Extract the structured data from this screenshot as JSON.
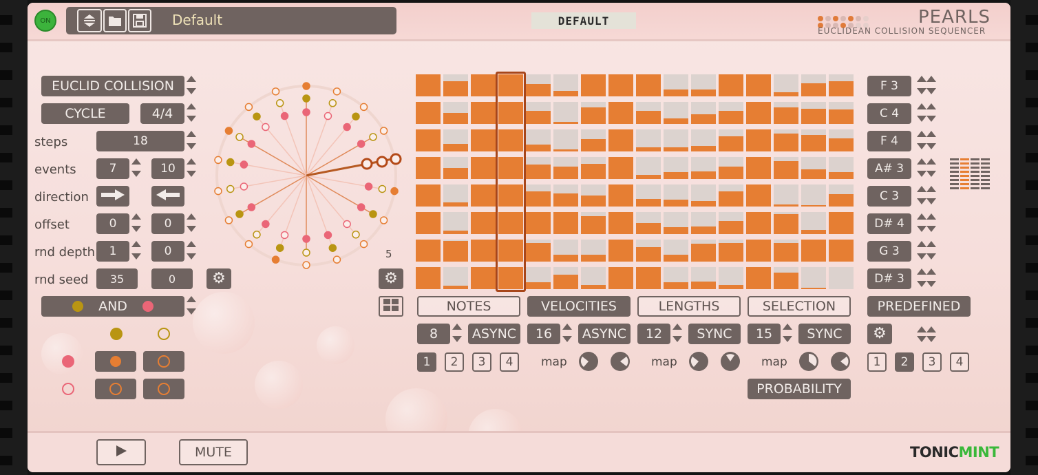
{
  "header": {
    "on_label": "ON",
    "preset_name": "Default",
    "preset_tag": "DEFAULT",
    "logo_title": "PEARLS",
    "logo_subtitle": "EUCLIDEAN COLLISION SEQUENCER",
    "icons": [
      "up-down-icon",
      "folder-icon",
      "save-icon"
    ]
  },
  "left": {
    "mode": "EUCLID COLLISION",
    "cycle_label": "CYCLE",
    "cycle_value": "4/4",
    "steps_label": "steps",
    "steps_value": "18",
    "events_label": "events",
    "events_a": "7",
    "events_b": "10",
    "direction_label": "direction",
    "offset_label": "offset",
    "offset_a": "0",
    "offset_b": "0",
    "rnd_depth_label": "rnd depth",
    "rnd_depth_a": "1",
    "rnd_depth_b": "0",
    "rnd_seed_label": "rnd seed",
    "rnd_seed_a": "35",
    "rnd_seed_b": "0",
    "logic_label": "AND"
  },
  "circle": {
    "count_label": "5"
  },
  "grid": {
    "fill_levels": [
      [
        1.0,
        0.7,
        1.0,
        1.0,
        0.55,
        0.25,
        1.0,
        1.0,
        1.0,
        0.3,
        0.3,
        1.0,
        1.0,
        0.2,
        0.6,
        0.7
      ],
      [
        1.0,
        0.5,
        1.0,
        1.0,
        0.6,
        0.1,
        0.75,
        1.0,
        0.6,
        0.25,
        0.45,
        0.6,
        1.0,
        0.75,
        0.7,
        0.65
      ],
      [
        1.0,
        0.35,
        1.0,
        1.0,
        0.3,
        0.1,
        0.55,
        1.0,
        0.2,
        0.2,
        0.25,
        0.7,
        1.0,
        0.8,
        0.75,
        0.6
      ],
      [
        1.0,
        0.5,
        1.0,
        1.0,
        0.65,
        0.55,
        0.7,
        1.0,
        0.2,
        0.3,
        0.35,
        0.55,
        1.0,
        0.8,
        0.45,
        0.3
      ],
      [
        1.0,
        0.2,
        1.0,
        1.0,
        0.7,
        0.6,
        0.5,
        1.0,
        0.35,
        0.3,
        0.25,
        0.7,
        1.0,
        0.1,
        0.05,
        0.55
      ],
      [
        1.0,
        0.15,
        1.0,
        1.0,
        1.0,
        1.0,
        0.8,
        1.0,
        0.5,
        0.3,
        0.35,
        0.6,
        1.0,
        0.9,
        0.2,
        1.0
      ],
      [
        1.0,
        0.95,
        1.0,
        1.0,
        0.85,
        0.3,
        0.3,
        1.0,
        0.65,
        0.3,
        0.8,
        0.85,
        1.0,
        0.85,
        1.0,
        1.0
      ],
      [
        1.0,
        0.15,
        1.0,
        1.0,
        0.3,
        0.65,
        0.2,
        1.0,
        1.0,
        0.3,
        0.35,
        0.2,
        1.0,
        0.75,
        0.05,
        0.0
      ]
    ],
    "current_step": 3
  },
  "notes_list": [
    "F 3",
    "C 4",
    "F 4",
    "A# 3",
    "C 3",
    "D# 4",
    "G 3",
    "D# 3"
  ],
  "tabs": {
    "notes": "NOTES",
    "velocities": "VELOCITIES",
    "lengths": "LENGTHS",
    "selection": "SELECTION",
    "predefined": "PREDEFINED"
  },
  "lanes": {
    "notes_len": "8",
    "notes_mode": "ASYNC",
    "vel_len": "16",
    "vel_mode": "ASYNC",
    "len_len": "12",
    "len_mode": "SYNC",
    "sel_len": "15",
    "sel_mode": "SYNC",
    "map_label": "map",
    "probability": "PROBABILITY",
    "pages": [
      "1",
      "2",
      "3",
      "4"
    ]
  },
  "footer": {
    "mute": "MUTE",
    "brand_a": "TONIC",
    "brand_b": "MINT"
  },
  "colors": {
    "accent": "#e67e33",
    "button": "#6f6360",
    "pink": "#ea6677",
    "gold": "#b99512",
    "brand_green": "#3ab83a"
  }
}
